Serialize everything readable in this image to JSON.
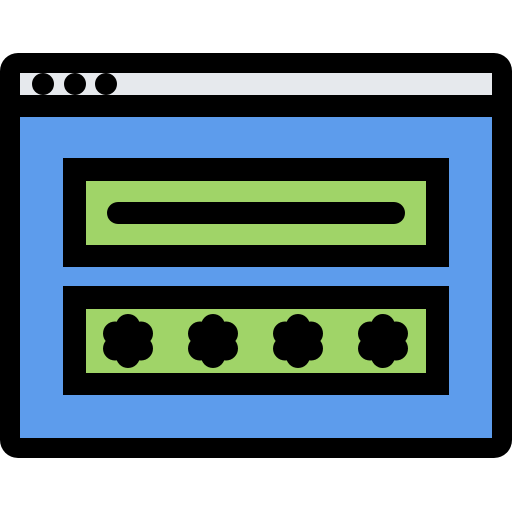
{
  "icon": {
    "name": "login-form-window-icon",
    "elements": {
      "window": "browser-window-icon",
      "controls": [
        "window-dot-icon",
        "window-dot-icon",
        "window-dot-icon"
      ],
      "username_field": "username-field-icon",
      "password_field": "password-field-icon",
      "password_mask": [
        "asterisk-icon",
        "asterisk-icon",
        "asterisk-icon",
        "asterisk-icon"
      ]
    }
  },
  "colors": {
    "outline": "#000000",
    "titlebar": "#e6e9ed",
    "window_body": "#5d9cec",
    "field_fill": "#a0d468",
    "background": "#ffffff"
  }
}
